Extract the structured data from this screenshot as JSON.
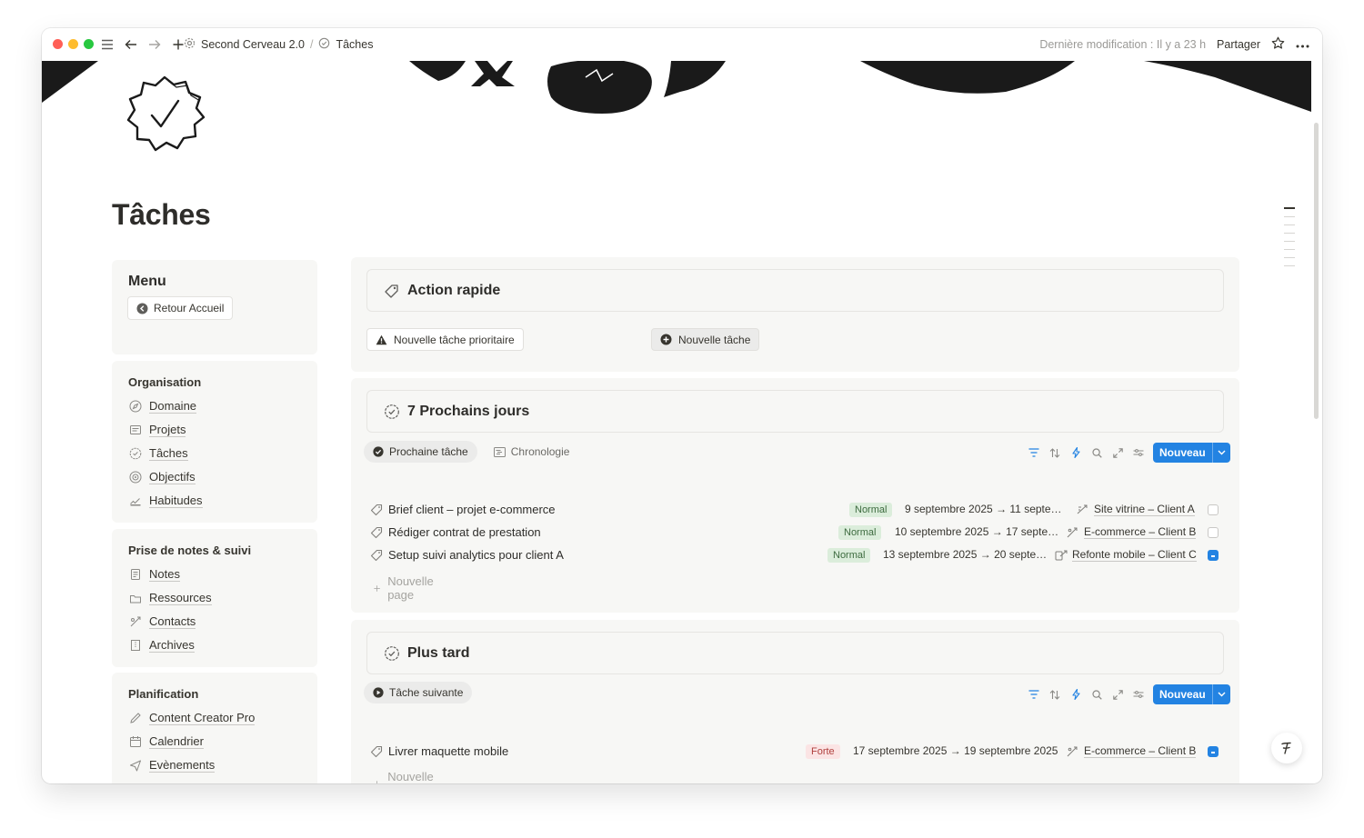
{
  "topbar": {
    "workspace": "Second Cerveau 2.0",
    "page": "Tâches",
    "last_modified": "Dernière modification : Il y a 23 h",
    "share": "Partager"
  },
  "page": {
    "title": "Tâches"
  },
  "sidebar": {
    "menu": {
      "title": "Menu",
      "back_button": "Retour Accueil"
    },
    "sections": [
      {
        "title": "Organisation",
        "items": [
          "Domaine",
          "Projets",
          "Tâches",
          "Objectifs",
          "Habitudes"
        ]
      },
      {
        "title": "Prise de notes & suivi",
        "items": [
          "Notes",
          "Ressources",
          "Contacts",
          "Archives"
        ]
      },
      {
        "title": "Planification",
        "items": [
          "Content Creator Pro",
          "Calendrier",
          "Evènements"
        ]
      }
    ]
  },
  "quick_action": {
    "title": "Action rapide",
    "priority_button": "Nouvelle tâche prioritaire",
    "new_button": "Nouvelle tâche"
  },
  "next7": {
    "title": "7 Prochains jours",
    "tabs": [
      "Prochaine tâche",
      "Chronologie"
    ],
    "new_label": "Nouveau",
    "rows": [
      {
        "name": "Brief client – projet e-commerce",
        "priority": "Normal",
        "date": "9 septembre 2025 → 11 septe…",
        "project": "Site vitrine – Client A",
        "done": false
      },
      {
        "name": "Rédiger contrat de prestation",
        "priority": "Normal",
        "date": "10 septembre 2025 → 17 septe…",
        "project": "E-commerce – Client B",
        "done": false
      },
      {
        "name": "Setup suivi analytics pour client A",
        "priority": "Normal",
        "date": "13 septembre 2025 → 20 septe…",
        "project": "Refonte mobile – Client C",
        "done": true
      }
    ],
    "new_page": "Nouvelle page"
  },
  "later": {
    "title": "Plus tard",
    "tabs": [
      "Tâche suivante"
    ],
    "new_label": "Nouveau",
    "rows": [
      {
        "name": "Livrer maquette mobile",
        "priority": "Forte",
        "date": "17 septembre 2025 → 19 septembre 2025",
        "project": "E-commerce – Client B",
        "done": true
      }
    ],
    "new_page": "Nouvelle page"
  },
  "colors": {
    "accent": "#2383e2",
    "card_bg": "#f7f7f5",
    "normal_tag": "#dbeddb",
    "forte_tag": "#fbe4e4"
  }
}
